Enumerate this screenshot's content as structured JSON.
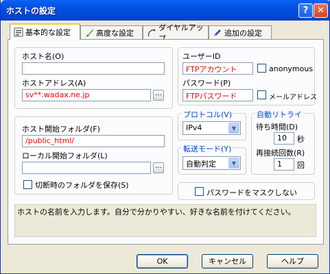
{
  "window": {
    "title": "ホストの設定",
    "help_glyph": "?",
    "close_glyph": "✕"
  },
  "tabs": [
    {
      "label": "基本的な設定",
      "icon": "basic-settings-icon"
    },
    {
      "label": "高度な設定",
      "icon": "brush-icon"
    },
    {
      "label": "ダイヤルアップ",
      "icon": "dialup-icon"
    },
    {
      "label": "追加の設定",
      "icon": "pen-icon"
    }
  ],
  "host": {
    "name_label": "ホスト名(O)",
    "name_value": "",
    "address_label": "ホストアドレス(A)",
    "address_value": "sv**.wadax.ne.jp"
  },
  "folders": {
    "host_folder_label": "ホスト開始フォルダ(F)",
    "host_folder_value": "/public_html/",
    "local_folder_label": "ローカル開始フォルダ(L)",
    "local_folder_value": "",
    "save_on_disconnect_label": "切断時のフォルダを保存(S)"
  },
  "auth": {
    "user_label": "ユーザーID",
    "user_value": "FTPアカウント",
    "anonymous_label": "anonymous",
    "password_label": "パスワード(P)",
    "password_value": "FTPパスワード",
    "mail_label": "メールアドレス"
  },
  "protocol": {
    "label": "プロトコル(V)",
    "value": "IPv4"
  },
  "transfer": {
    "label": "転送モード(Y)",
    "value": "自動判定"
  },
  "retry": {
    "label": "自動リトライ",
    "wait_label": "待ち時間(D)",
    "wait_value": "10",
    "wait_unit": "秒",
    "reconnect_label": "再接続回数(R)",
    "reconnect_value": "1",
    "reconnect_unit": "回"
  },
  "mask_password_label": "パスワードをマスクしない",
  "description": "ホストの名前を入力します。自分で分かりやすい、好きな名前を付けてください。",
  "buttons": {
    "browse": "...",
    "ok": "OK",
    "cancel": "キャンセル",
    "help": "ヘルプ"
  }
}
